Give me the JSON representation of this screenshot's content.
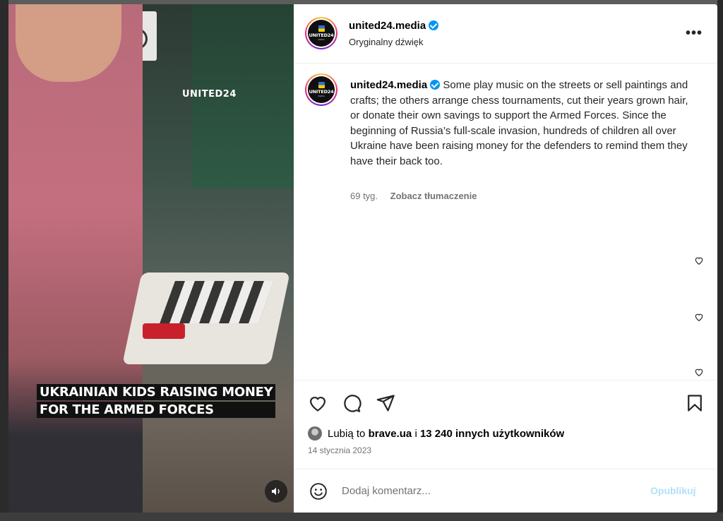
{
  "video": {
    "watermark": "UNITED24",
    "caption_lines": [
      "UKRAINIAN KIDS RAISING MONEY",
      "FOR THE ARMED FORCES"
    ],
    "audio_icon": "speaker-icon"
  },
  "header": {
    "username": "united24.media",
    "subtitle": "Oryginalny dźwięk",
    "more_icon": "more-horizontal-icon",
    "more_label": "•••"
  },
  "avatar": {
    "brand": "UNITED24",
    "sub": "MEDIA"
  },
  "post": {
    "username": "united24.media",
    "text": "Some play music on the streets or sell paintings and crafts; the others arrange chess tournaments, cut their years grown hair, or donate their own savings to support the Armed Forces. Since the beginning of Russia’s full-scale invasion, hundreds of children all over Ukraine have been raising money for the defenders to remind them they have their back too.",
    "age": "69 tyg.",
    "translate_label": "Zobacz tłumaczenie"
  },
  "actions": {
    "like_icon": "heart-icon",
    "comment_icon": "comment-icon",
    "share_icon": "send-icon",
    "save_icon": "bookmark-icon"
  },
  "likes": {
    "prefix": "Lubią to",
    "user": "brave.ua",
    "joiner": "i",
    "others": "13 240 innych użytkowników"
  },
  "date": "14 stycznia 2023",
  "comment_bar": {
    "emoji_icon": "emoji-icon",
    "placeholder": "Dodaj komentarz...",
    "publish_label": "Opublikuj"
  },
  "colors": {
    "verified": "#0095f6",
    "publish_disabled": "#b2dffc",
    "muted_text": "#737373"
  }
}
